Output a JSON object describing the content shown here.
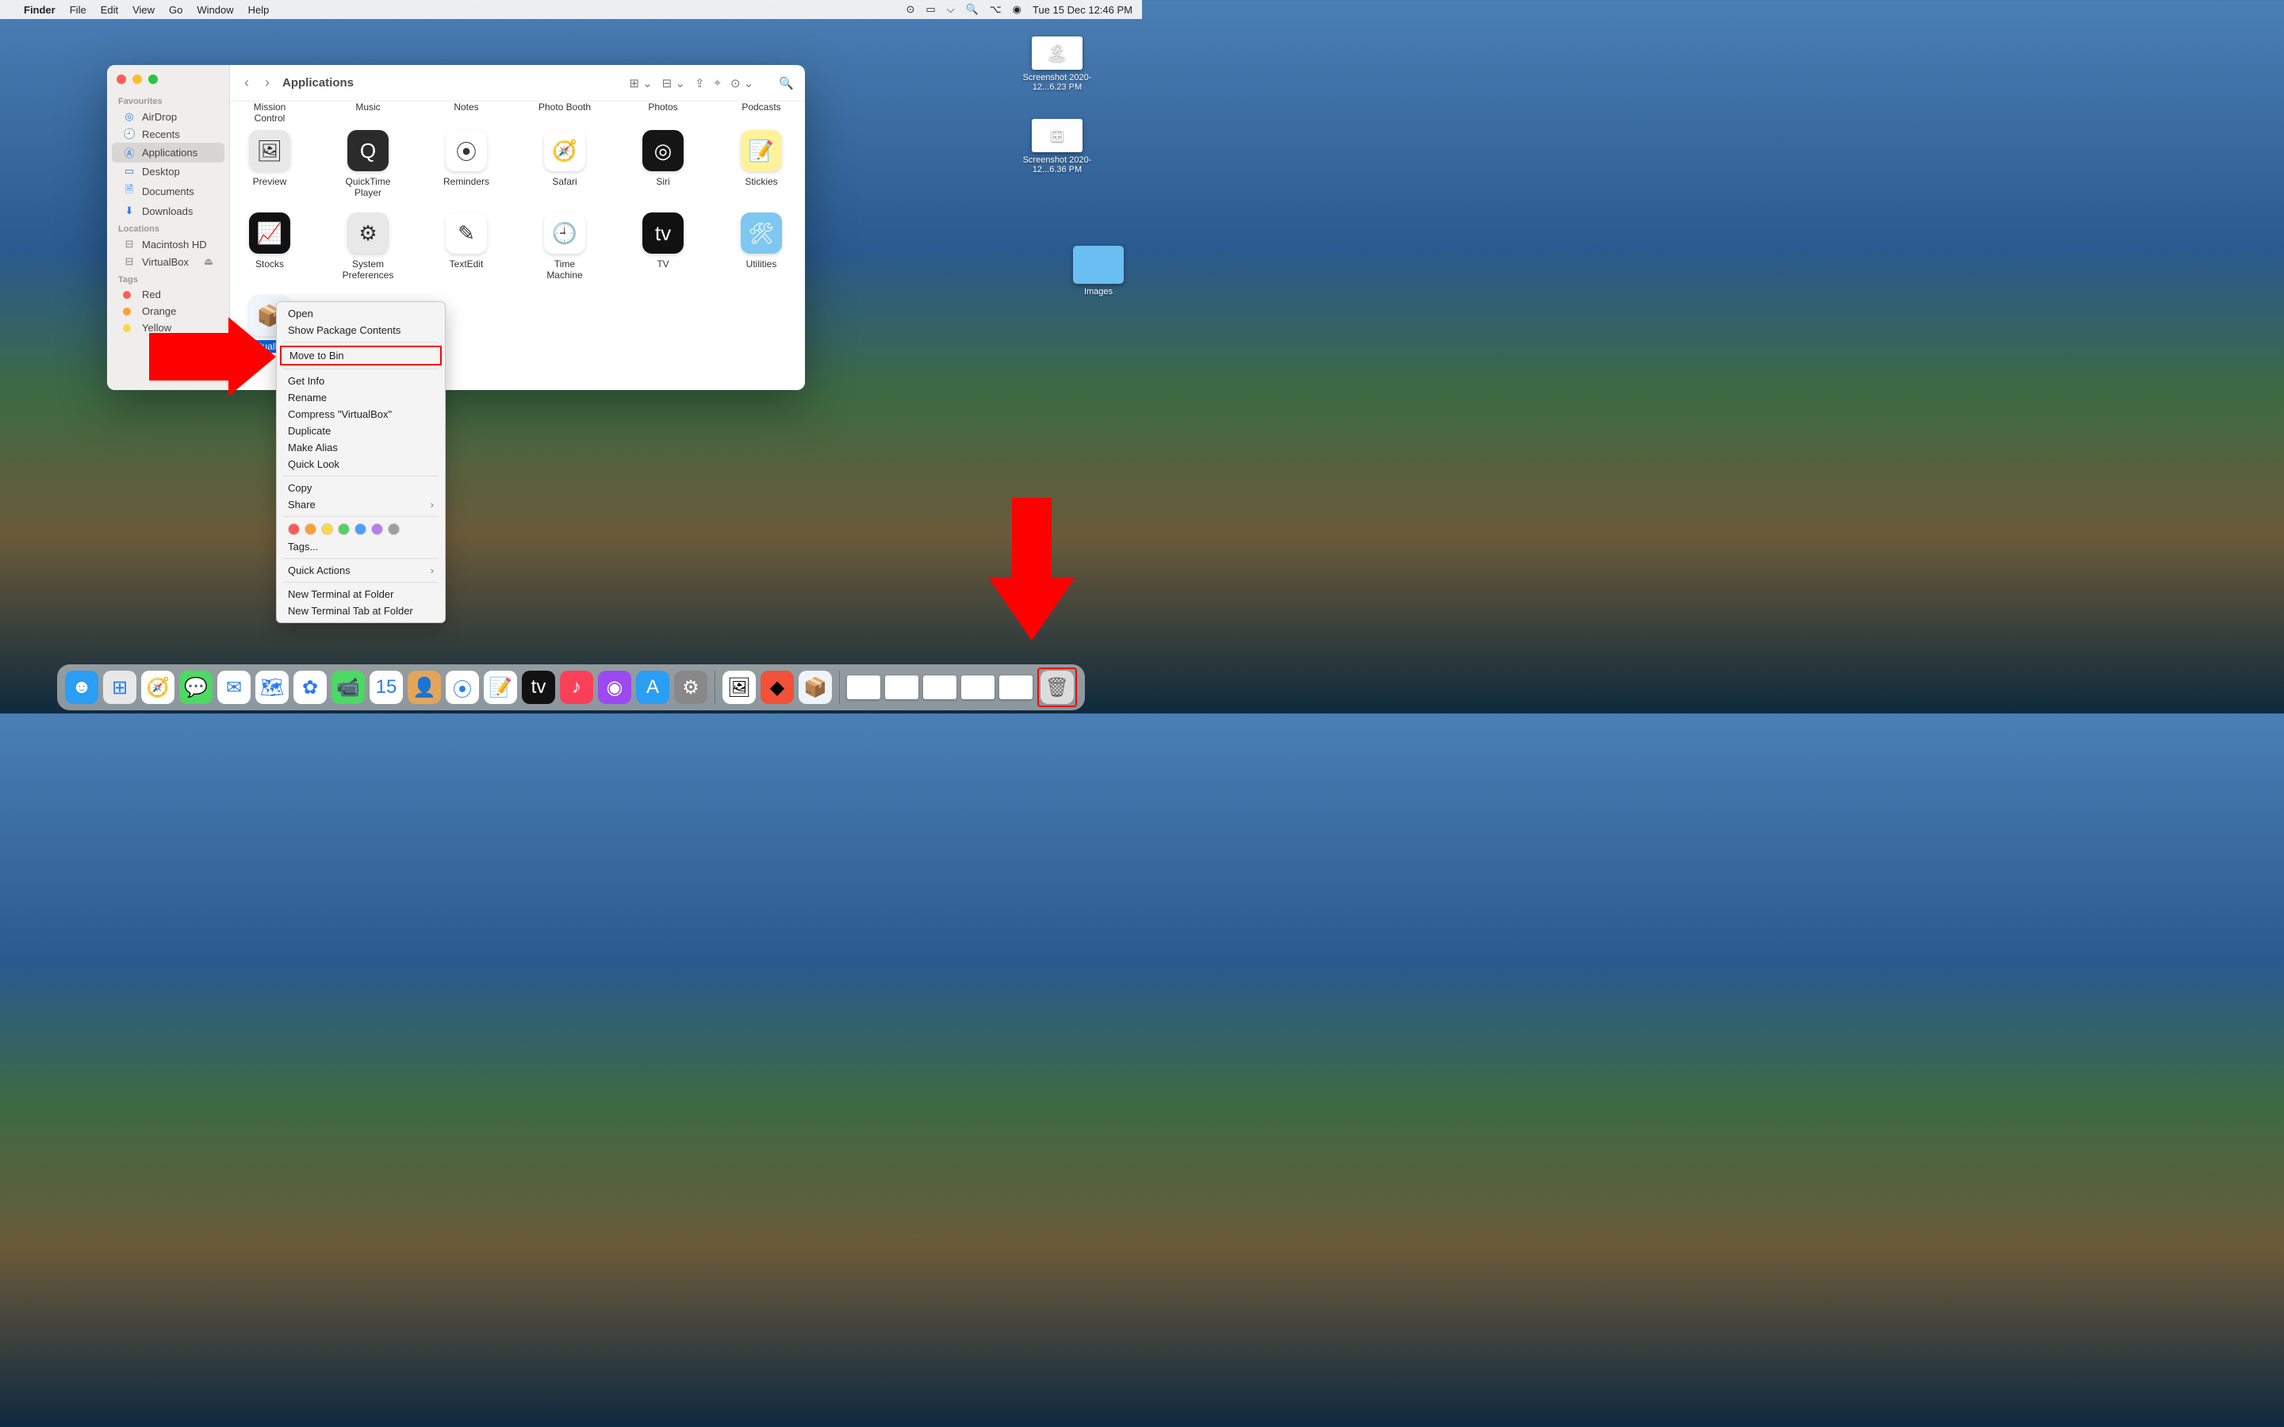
{
  "menubar": {
    "app": "Finder",
    "items": [
      "File",
      "Edit",
      "View",
      "Go",
      "Window",
      "Help"
    ],
    "clock": "Tue 15 Dec  12:46 PM"
  },
  "desktop": {
    "icon1": {
      "label": "Screenshot 2020-12...6.23 PM"
    },
    "icon2": {
      "label": "Screenshot 2020-12...6.36 PM"
    },
    "folder": {
      "label": "Images"
    }
  },
  "finder": {
    "title": "Applications",
    "sidebar": {
      "favourites_title": "Favourites",
      "favourites": [
        "AirDrop",
        "Recents",
        "Applications",
        "Desktop",
        "Documents",
        "Downloads"
      ],
      "locations_title": "Locations",
      "locations": [
        "Macintosh HD",
        "VirtualBox"
      ],
      "tags_title": "Tags",
      "tags": [
        {
          "name": "Red",
          "color": "#ff5b55"
        },
        {
          "name": "Orange",
          "color": "#ff9f38"
        },
        {
          "name": "Yellow",
          "color": "#ffd744"
        }
      ]
    },
    "label_row": [
      "Mission Control",
      "Music",
      "Notes",
      "Photo Booth",
      "Photos",
      "Podcasts"
    ],
    "row2": [
      {
        "name": "Preview",
        "bg": "#e8e8e8",
        "glyph": "🖼"
      },
      {
        "name": "QuickTime Player",
        "bg": "#2b2b2b",
        "glyph": "Q"
      },
      {
        "name": "Reminders",
        "bg": "#ffffff",
        "glyph": "⦿"
      },
      {
        "name": "Safari",
        "bg": "#ffffff",
        "glyph": "🧭"
      },
      {
        "name": "Siri",
        "bg": "#151515",
        "glyph": "◎"
      },
      {
        "name": "Stickies",
        "bg": "#fff29a",
        "glyph": "📝"
      }
    ],
    "row3": [
      {
        "name": "Stocks",
        "bg": "#111111",
        "glyph": "📈"
      },
      {
        "name": "System Preferences",
        "bg": "#e8e8e8",
        "glyph": "⚙"
      },
      {
        "name": "TextEdit",
        "bg": "#ffffff",
        "glyph": "✎"
      },
      {
        "name": "Time Machine",
        "bg": "#ffffff",
        "glyph": "🕘"
      },
      {
        "name": "TV",
        "bg": "#111111",
        "glyph": "tv"
      },
      {
        "name": "Utilities",
        "bg": "#7ec7f0",
        "glyph": "🛠"
      }
    ],
    "row4": [
      {
        "name": "VirtualBox",
        "bg": "#eef4fb",
        "glyph": "📦",
        "selected": true
      }
    ]
  },
  "context_menu": {
    "items_top": [
      "Open",
      "Show Package Contents"
    ],
    "highlighted": "Move to Bin",
    "items_mid": [
      "Get Info",
      "Rename",
      "Compress \"VirtualBox\"",
      "Duplicate",
      "Make Alias",
      "Quick Look"
    ],
    "copy": "Copy",
    "share": "Share",
    "tags_label": "Tags...",
    "quick_actions": "Quick Actions",
    "terminal": [
      "New Terminal at Folder",
      "New Terminal Tab at Folder"
    ],
    "tag_colors": [
      "#ff5b55",
      "#ff9f38",
      "#ffd744",
      "#52d060",
      "#4a9fff",
      "#b77de8",
      "#9e9e9e"
    ]
  },
  "dock": {
    "apps": [
      {
        "name": "Finder",
        "bg": "#2a9df4",
        "glyph": "☻"
      },
      {
        "name": "Launchpad",
        "bg": "#e8e8e8",
        "glyph": "⊞"
      },
      {
        "name": "Safari",
        "bg": "#fff",
        "glyph": "🧭"
      },
      {
        "name": "Messages",
        "bg": "#4cd964",
        "glyph": "💬"
      },
      {
        "name": "Mail",
        "bg": "#fff",
        "glyph": "✉"
      },
      {
        "name": "Maps",
        "bg": "#fff",
        "glyph": "🗺"
      },
      {
        "name": "Photos",
        "bg": "#fff",
        "glyph": "✿"
      },
      {
        "name": "FaceTime",
        "bg": "#4cd964",
        "glyph": "📹"
      },
      {
        "name": "Calendar",
        "bg": "#fff",
        "glyph": "15"
      },
      {
        "name": "Contacts",
        "bg": "#e2a55b",
        "glyph": "👤"
      },
      {
        "name": "Reminders",
        "bg": "#fff",
        "glyph": "⦿"
      },
      {
        "name": "Notes",
        "bg": "#fff",
        "glyph": "📝"
      },
      {
        "name": "TV",
        "bg": "#111",
        "glyph": "tv"
      },
      {
        "name": "Music",
        "bg": "#fa4059",
        "glyph": "♪"
      },
      {
        "name": "Podcasts",
        "bg": "#9a4af0",
        "glyph": "◉"
      },
      {
        "name": "App Store",
        "bg": "#2a9df4",
        "glyph": "A"
      },
      {
        "name": "System Preferences",
        "bg": "#888",
        "glyph": "⚙"
      }
    ],
    "extra": [
      {
        "name": "Preview-doc",
        "bg": "#fff",
        "glyph": "🖼"
      },
      {
        "name": "Swift",
        "bg": "#f05138",
        "glyph": "◆"
      },
      {
        "name": "VirtualBox",
        "bg": "#eef4fb",
        "glyph": "📦"
      }
    ],
    "minimized_count": 5,
    "trash": "Trash"
  }
}
